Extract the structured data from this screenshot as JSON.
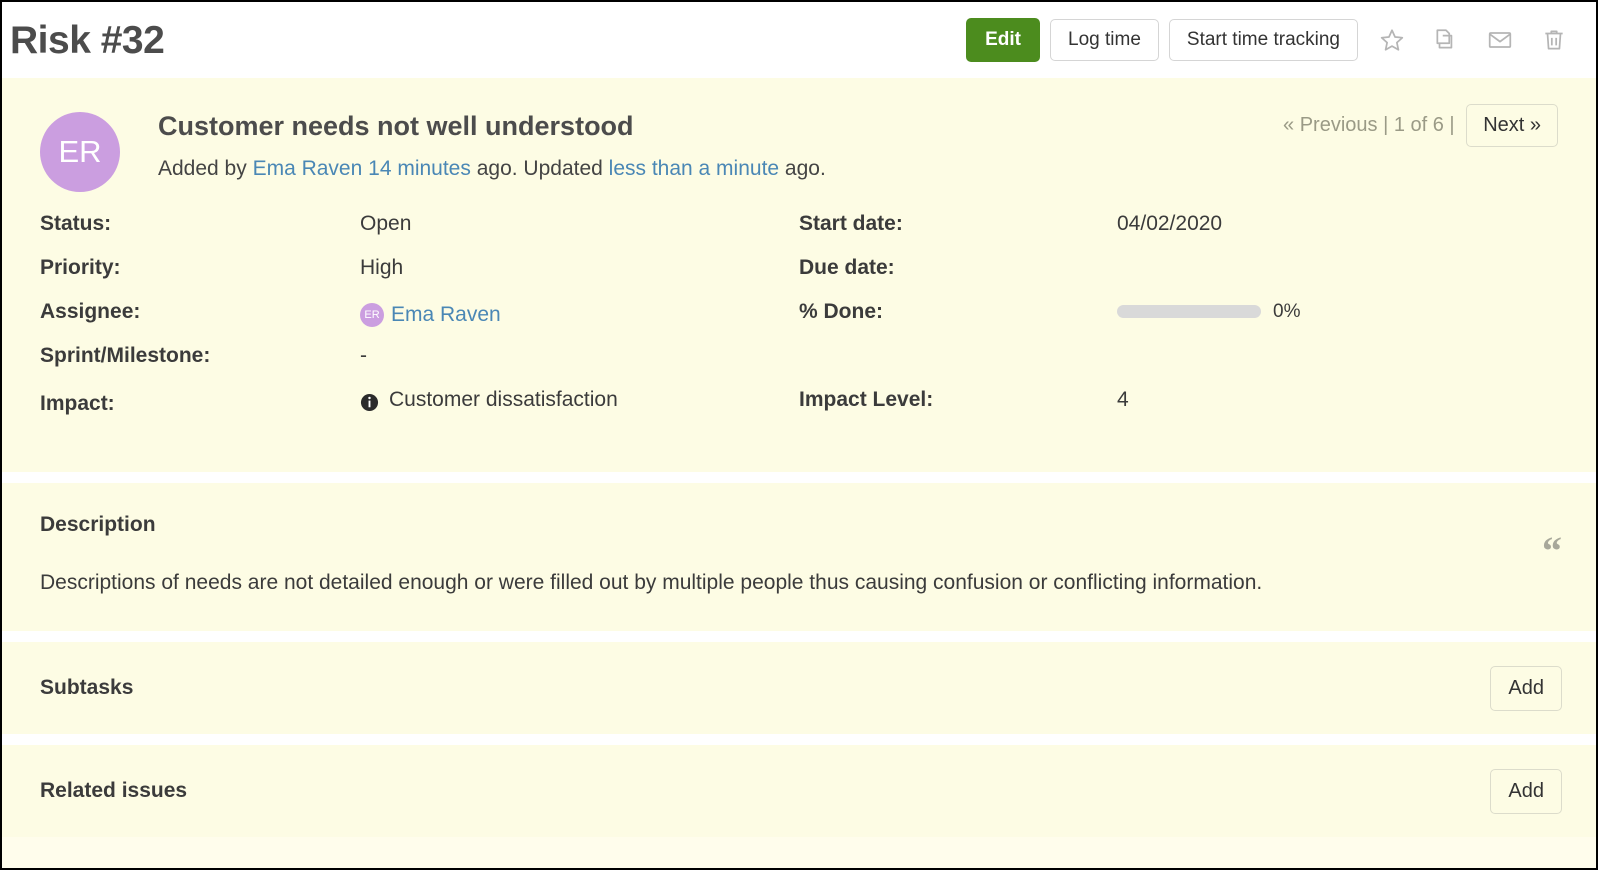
{
  "header": {
    "title": "Risk #32",
    "actions": {
      "edit_label": "Edit",
      "log_time_label": "Log time",
      "start_time_tracking_label": "Start time tracking"
    },
    "icons": {
      "watch": "star-icon",
      "copy": "copy-icon",
      "email": "envelope-icon",
      "delete": "trash-icon"
    }
  },
  "issue": {
    "avatar_initials": "ER",
    "subject": "Customer needs not well understood",
    "author_line": {
      "added_by_prefix": "Added by ",
      "author_name": "Ema Raven",
      "created_ago": "14 minutes",
      "middle": " ago. Updated ",
      "updated_ago": "less than a minute",
      "suffix": " ago."
    }
  },
  "pagination": {
    "previous_label": "« Previous",
    "separator_left": " | ",
    "position_label": "1 of 6",
    "separator_right": " | ",
    "next_label": "Next »"
  },
  "attributes": {
    "left": [
      {
        "label": "Status:",
        "value": "Open"
      },
      {
        "label": "Priority:",
        "value": "High"
      },
      {
        "label": "Assignee:",
        "value": "Ema Raven",
        "avatar_initials": "ER",
        "is_link": true
      },
      {
        "label": "Sprint/Milestone:",
        "value": "-"
      },
      {
        "label": "Impact:",
        "value": "Customer dissatisfaction",
        "has_info_icon": true
      }
    ],
    "right": [
      {
        "label": "Start date:",
        "value": "04/02/2020"
      },
      {
        "label": "Due date:",
        "value": ""
      },
      {
        "label": "% Done:",
        "value": "0%",
        "percent": 0
      },
      {
        "label": "",
        "value": ""
      },
      {
        "label": "Impact Level:",
        "value": "4"
      }
    ]
  },
  "description": {
    "title": "Description",
    "body": "Descriptions of needs are not detailed enough or were filled out by multiple people thus causing confusion or conflicting information.",
    "quote_glyph": "“"
  },
  "subtasks": {
    "title": "Subtasks",
    "add_label": "Add"
  },
  "related_issues": {
    "title": "Related issues",
    "add_label": "Add"
  },
  "colors": {
    "accent_green": "#4c8c1e",
    "link_blue": "#4a87b5",
    "body_bg": "#fdfce4",
    "avatar_purple": "#cb9ee0",
    "progress_track": "#d9d9d9"
  }
}
